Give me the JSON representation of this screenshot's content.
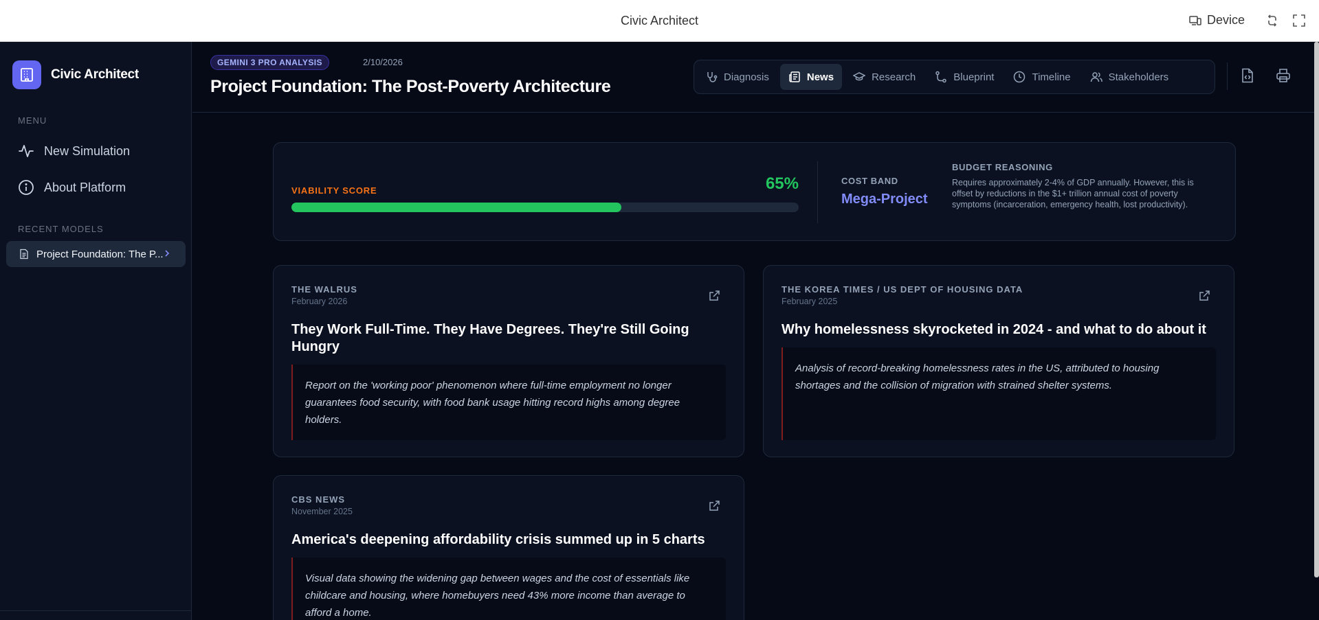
{
  "topbar": {
    "title": "Civic Architect",
    "device_label": "Device"
  },
  "sidebar": {
    "brand": "Civic Architect",
    "menu_heading": "MENU",
    "menu": [
      {
        "label": "New Simulation",
        "icon": "activity-icon"
      },
      {
        "label": "About Platform",
        "icon": "info-icon"
      }
    ],
    "recent_heading": "RECENT MODELS",
    "recent": [
      {
        "label": "Project Foundation: The P...",
        "icon": "document-icon"
      }
    ]
  },
  "header": {
    "badge": "GEMINI 3 PRO ANALYSIS",
    "date": "2/10/2026",
    "title": "Project Foundation: The Post-Poverty Architecture",
    "tabs": [
      {
        "label": "Diagnosis",
        "icon": "stethoscope-icon",
        "active": false
      },
      {
        "label": "News",
        "icon": "newspaper-icon",
        "active": true
      },
      {
        "label": "Research",
        "icon": "graduation-cap-icon",
        "active": false
      },
      {
        "label": "Blueprint",
        "icon": "route-icon",
        "active": false
      },
      {
        "label": "Timeline",
        "icon": "clock-icon",
        "active": false
      },
      {
        "label": "Stakeholders",
        "icon": "users-icon",
        "active": false
      }
    ]
  },
  "viability": {
    "label": "VIABILITY SCORE",
    "value_text": "65%",
    "score": 0.65,
    "cost_band_label": "COST BAND",
    "cost_band": "Mega-Project",
    "budget_label": "BUDGET REASONING",
    "budget_text": "Requires approximately 2-4% of GDP annually. However, this is offset by reductions in the $1+ trillion annual cost of poverty symptoms (incarceration, emergency health, lost productivity)."
  },
  "news": [
    {
      "source": "THE WALRUS",
      "date": "February 2026",
      "title": "They Work Full-Time. They Have Degrees. They're Still Going Hungry",
      "summary": "Report on the 'working poor' phenomenon where full-time employment no longer guarantees food security, with food bank usage hitting record highs among degree holders."
    },
    {
      "source": "THE KOREA TIMES / US DEPT OF HOUSING DATA",
      "date": "February 2025",
      "title": "Why homelessness skyrocketed in 2024 - and what to do about it",
      "summary": "Analysis of record-breaking homelessness rates in the US, attributed to housing shortages and the collision of migration with strained shelter systems."
    },
    {
      "source": "CBS NEWS",
      "date": "November 2025",
      "title": "America's deepening affordability crisis summed up in 5 charts",
      "summary": "Visual data showing the widening gap between wages and the cost of essentials like childcare and housing, where homebuyers need 43% more income than average to afford a home."
    }
  ],
  "colors": {
    "accent": "#6366f1",
    "score": "#22c55e",
    "score_label": "#f97316",
    "cost_band": "#818cf8"
  }
}
